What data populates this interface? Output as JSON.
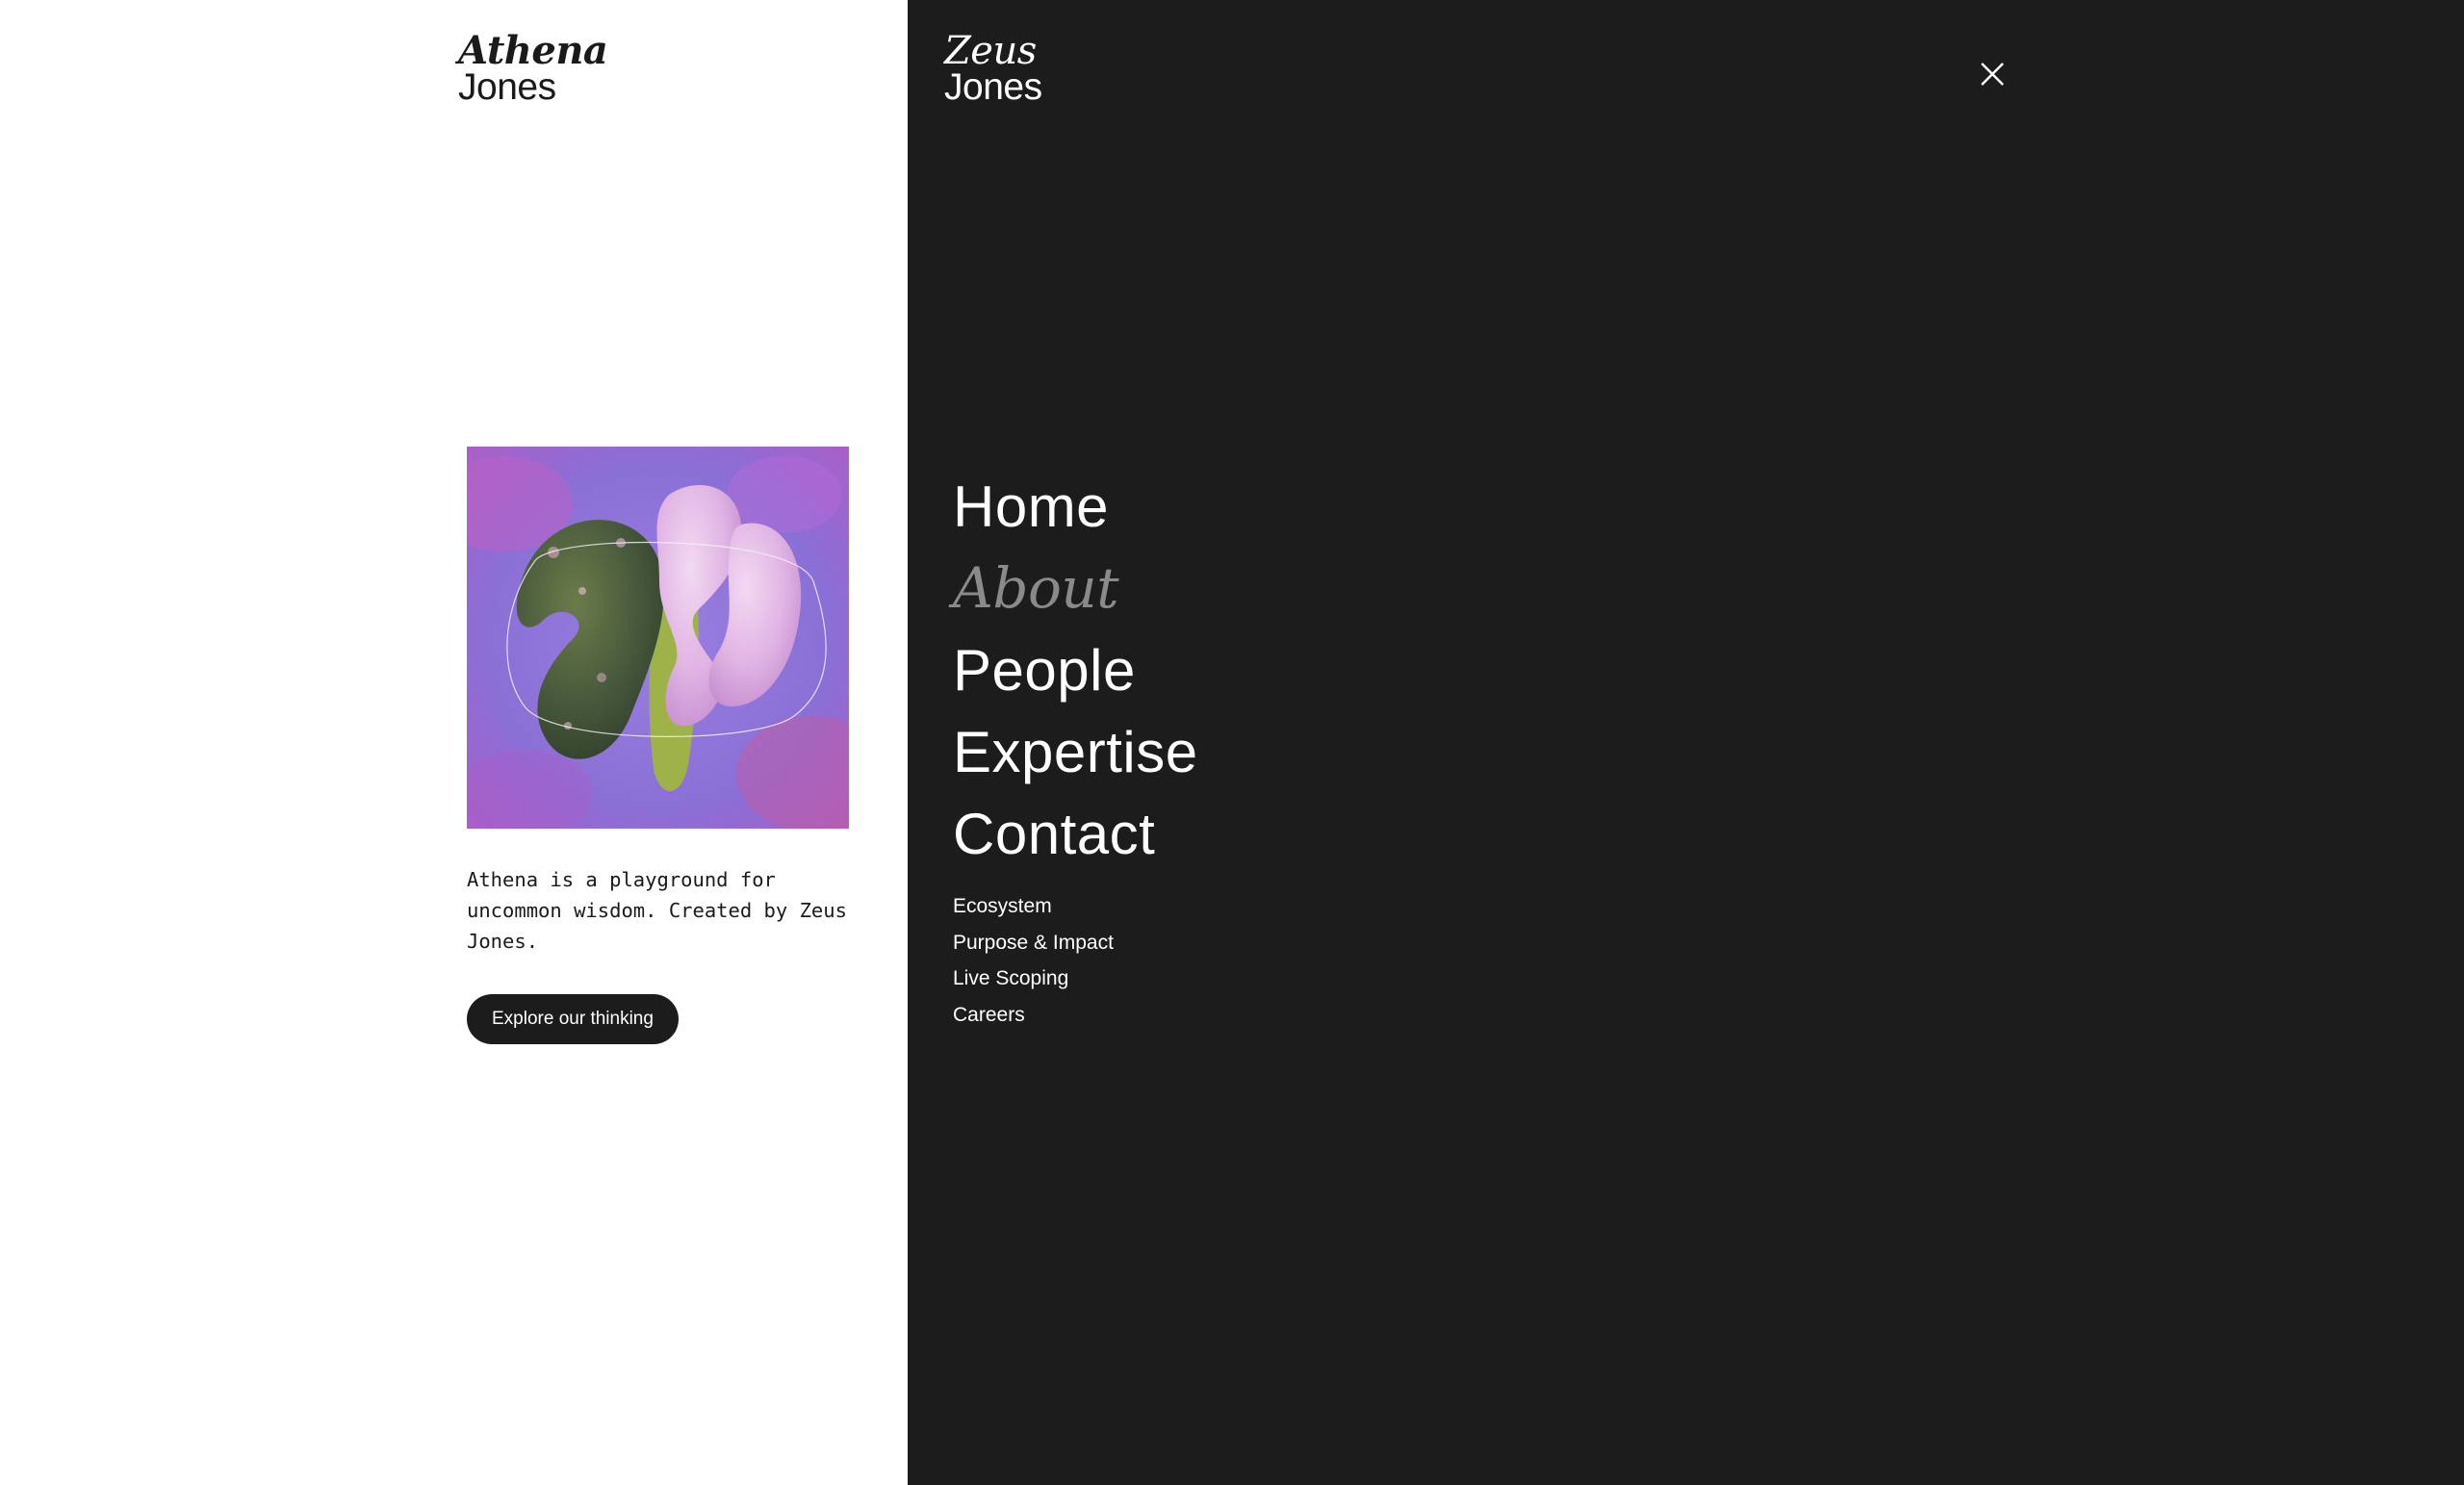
{
  "left_logo": {
    "line1": "Athena",
    "line2": "Jones"
  },
  "right_logo": {
    "line1": "Zeus",
    "line2": "Jones"
  },
  "hero_image": {
    "subject": "green mossy abstract sculpture intertwined with pink organic form on purple background"
  },
  "tagline": "Athena is a playground for uncommon wisdom. Created by Zeus Jones.",
  "cta_label": "Explore our thinking",
  "close_icon": "close-icon",
  "nav": {
    "items": [
      {
        "label": "Home",
        "active": false
      },
      {
        "label": "About",
        "active": true
      },
      {
        "label": "People",
        "active": false
      },
      {
        "label": "Expertise",
        "active": false
      },
      {
        "label": "Contact",
        "active": false
      }
    ],
    "secondary": [
      {
        "label": "Ecosystem"
      },
      {
        "label": "Purpose & Impact"
      },
      {
        "label": "Live Scoping"
      },
      {
        "label": "Careers"
      }
    ]
  },
  "colors": {
    "dark_panel": "#1c1c1c",
    "light_panel": "#ffffff",
    "active_nav": "#8a8a8a",
    "text_light": "#ffffff",
    "text_dark": "#1a1a1a"
  }
}
